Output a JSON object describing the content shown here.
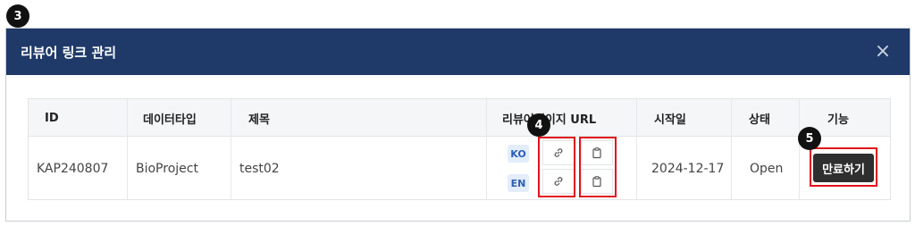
{
  "dialog": {
    "title": "리뷰어 링크 관리",
    "close_label": "×"
  },
  "markers": [
    "3",
    "4",
    "5"
  ],
  "table": {
    "headers": [
      "ID",
      "데이터타입",
      "제목",
      "리뷰어페이지 URL",
      "시작일",
      "상태",
      "기능"
    ],
    "row": {
      "id": "KAP240807",
      "data_type": "BioProject",
      "title": "test02",
      "languages": [
        "KO",
        "EN"
      ],
      "start_date": "2024-12-17",
      "status": "Open",
      "action_label": "만료하기"
    }
  },
  "icons": {
    "link": "link-icon",
    "copy": "clipboard-icon",
    "close": "close-icon"
  },
  "colors": {
    "header_bg": "#1f3a68",
    "highlight": "#e0121b",
    "badge_bg": "#e3edfb",
    "badge_text": "#2b5fb4",
    "action_bg": "#2f2f2f"
  }
}
